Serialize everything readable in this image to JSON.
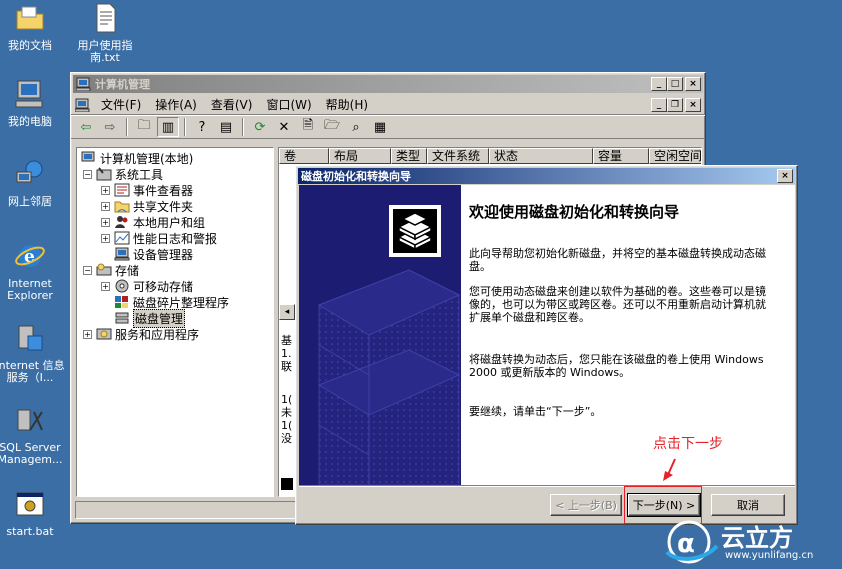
{
  "desktop": {
    "icons": [
      {
        "label": "我的文档"
      },
      {
        "label": "用户使用指南.txt"
      },
      {
        "label": "我的电脑"
      },
      {
        "label": "网上邻居"
      },
      {
        "label": "Internet Explorer"
      },
      {
        "label": "Internet 信息服务（I..."
      },
      {
        "label": "SQL Server Managem..."
      },
      {
        "label": "start.bat"
      }
    ]
  },
  "mmc": {
    "title": "计算机管理",
    "menu": [
      "文件(F)",
      "操作(A)",
      "查看(V)",
      "窗口(W)",
      "帮助(H)"
    ],
    "tree": [
      {
        "label": "计算机管理(本地)"
      },
      {
        "label": "系统工具"
      },
      {
        "label": "事件查看器"
      },
      {
        "label": "共享文件夹"
      },
      {
        "label": "本地用户和组"
      },
      {
        "label": "性能日志和警报"
      },
      {
        "label": "设备管理器"
      },
      {
        "label": "存储"
      },
      {
        "label": "可移动存储"
      },
      {
        "label": "磁盘碎片整理程序"
      },
      {
        "label": "磁盘管理"
      },
      {
        "label": "服务和应用程序"
      }
    ],
    "columns": [
      "卷",
      "布局",
      "类型",
      "文件系统",
      "状态",
      "容量",
      "空闲空间"
    ],
    "side_fragments": [
      "基",
      "1.",
      "联",
      "1(",
      "未",
      "1(",
      "没"
    ]
  },
  "wizard": {
    "title": "磁盘初始化和转换向导",
    "heading": "欢迎使用磁盘初始化和转换向导",
    "p1": "此向导帮助您初始化新磁盘，并将空的基本磁盘转换成动态磁盘。",
    "p2": "您可使用动态磁盘来创建以软件为基础的卷。这些卷可以是镜像的，也可以为带区或跨区卷。还可以不用重新启动计算机就扩展单个磁盘和跨区卷。",
    "p3": "将磁盘转换为动态后，您只能在该磁盘的卷上使用 Windows 2000 或更新版本的 Windows。",
    "p4": "要继续，请单击“下一步”。",
    "back_label": "< 上一步(B)",
    "next_label": "下一步(N) >",
    "cancel_label": "取消",
    "close_glyph": "×"
  },
  "annotation": {
    "text": "点击下一步",
    "color": "#e8202a"
  },
  "watermark": {
    "brand": "云立方",
    "url": "www.yunlifang.cn"
  }
}
